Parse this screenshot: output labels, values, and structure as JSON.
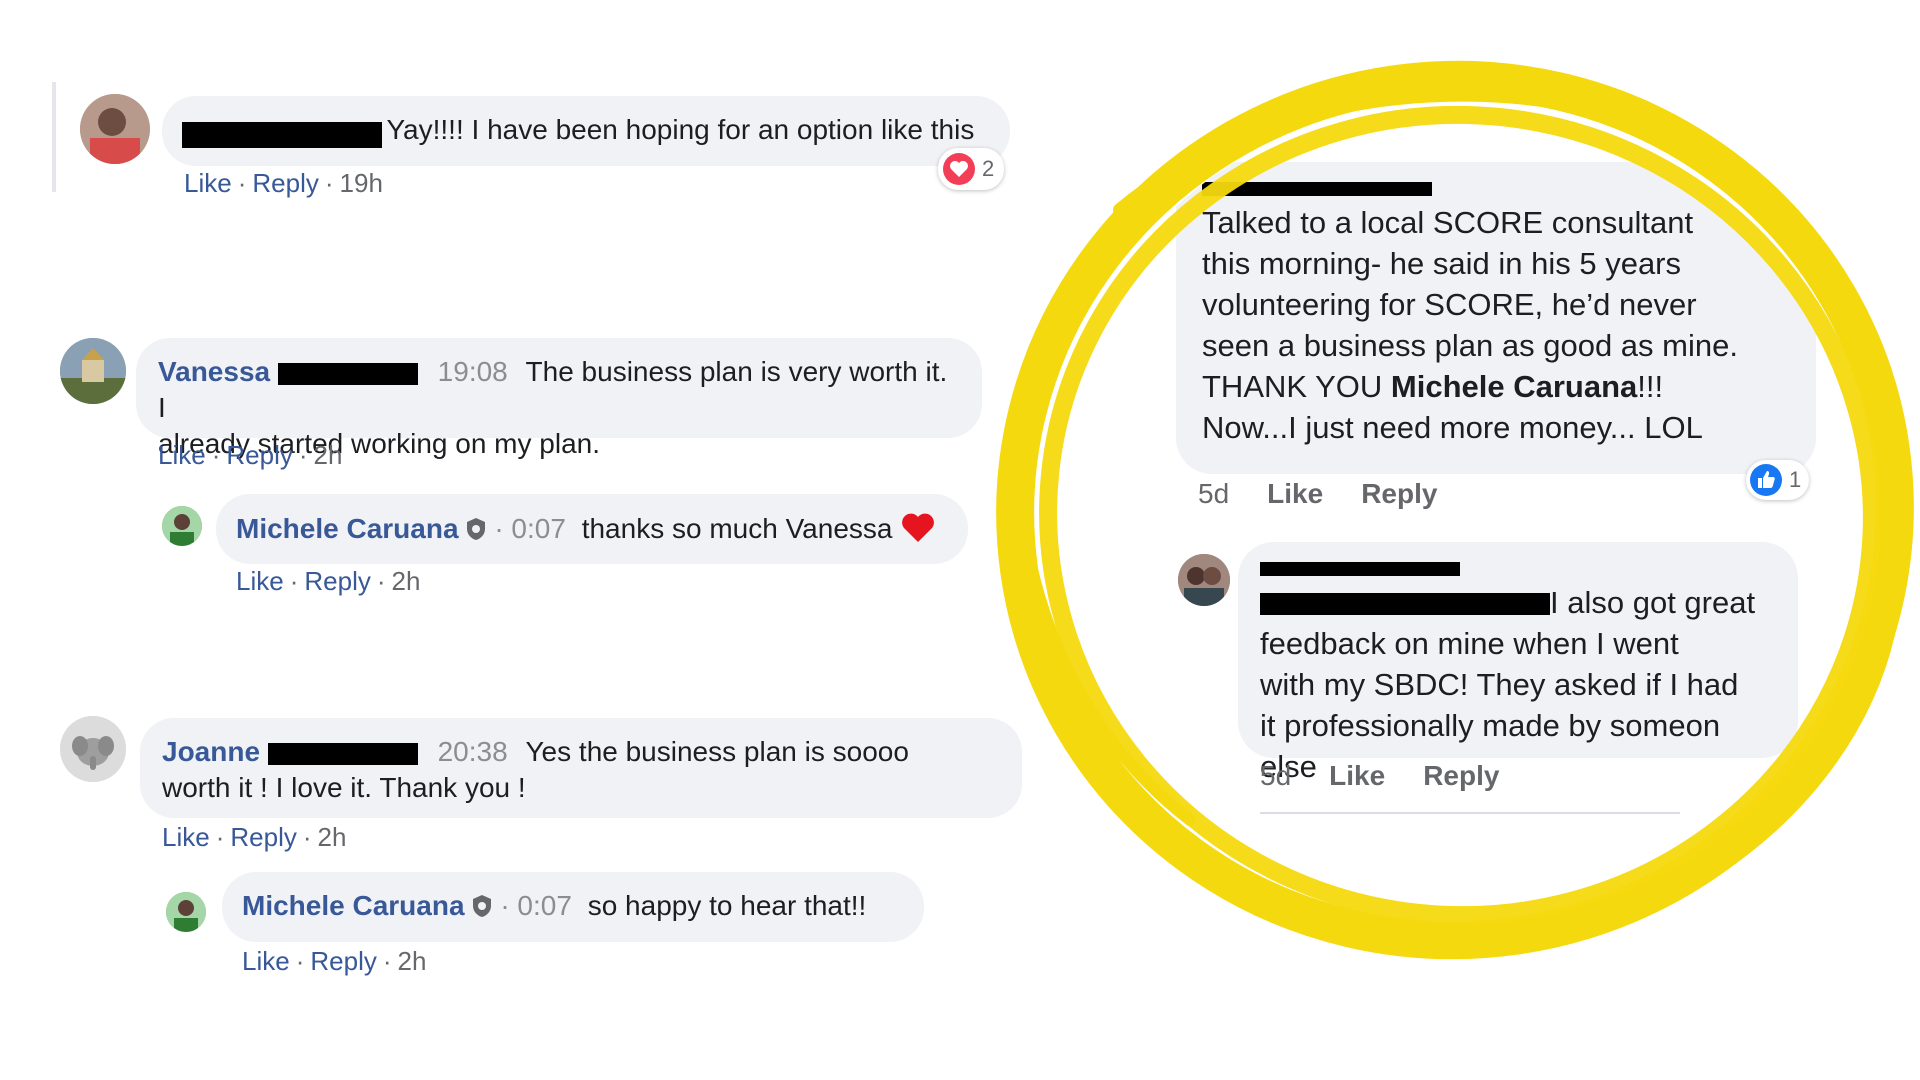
{
  "left_comments": [
    {
      "text": "Yay!!!! I have been hoping for an option like this",
      "actions": {
        "like": "Like",
        "reply": "Reply",
        "time": "19h"
      },
      "reaction_count": "2"
    },
    {
      "name": "Vanessa",
      "time": "19:08",
      "text_line1": "The business plan is very worth it. I",
      "text_line2": "already started working on my plan.",
      "actions": {
        "like": "Like",
        "reply": "Reply",
        "time": "2h"
      },
      "reply": {
        "name": "Michele Caruana",
        "time": "0:07",
        "text": "thanks so much Vanessa",
        "actions": {
          "like": "Like",
          "reply": "Reply",
          "time": "2h"
        }
      }
    },
    {
      "name": "Joanne",
      "time": "20:38",
      "text_line1": "Yes the business plan is soooo",
      "text_line2": "worth it ! I love it. Thank you !",
      "actions": {
        "like": "Like",
        "reply": "Reply",
        "time": "2h"
      },
      "reply": {
        "name": "Michele Caruana",
        "time": "0:07",
        "text": "so happy to hear that!!",
        "actions": {
          "like": "Like",
          "reply": "Reply",
          "time": "2h"
        }
      }
    }
  ],
  "right_comments": [
    {
      "lines": [
        "Talked to a local SCORE consultant",
        "this morning- he said in his 5 years",
        "volunteering for SCORE, he’d never",
        "seen a business plan as good as mine."
      ],
      "thanks_prefix": "THANK YOU ",
      "thanks_name": "Michele Caruana",
      "thanks_suffix": "!!!",
      "last_line": "Now...I just need more money... LOL",
      "actions": {
        "time": "5d",
        "like": "Like",
        "reply": "Reply"
      },
      "reaction_count": "1"
    },
    {
      "first_line": "I also got great",
      "lines": [
        "feedback on mine when I went",
        "with my SBDC! They asked if I had",
        "it professionally made by someon",
        "else"
      ],
      "actions": {
        "time": "5d",
        "like": "Like",
        "reply": "Reply"
      }
    }
  ],
  "colors": {
    "highlight_ring": "#f5d90f",
    "link_blue": "#385898",
    "bubble_bg": "#f0f2f5",
    "heart_red": "#f33e58",
    "like_blue": "#1877f2"
  }
}
